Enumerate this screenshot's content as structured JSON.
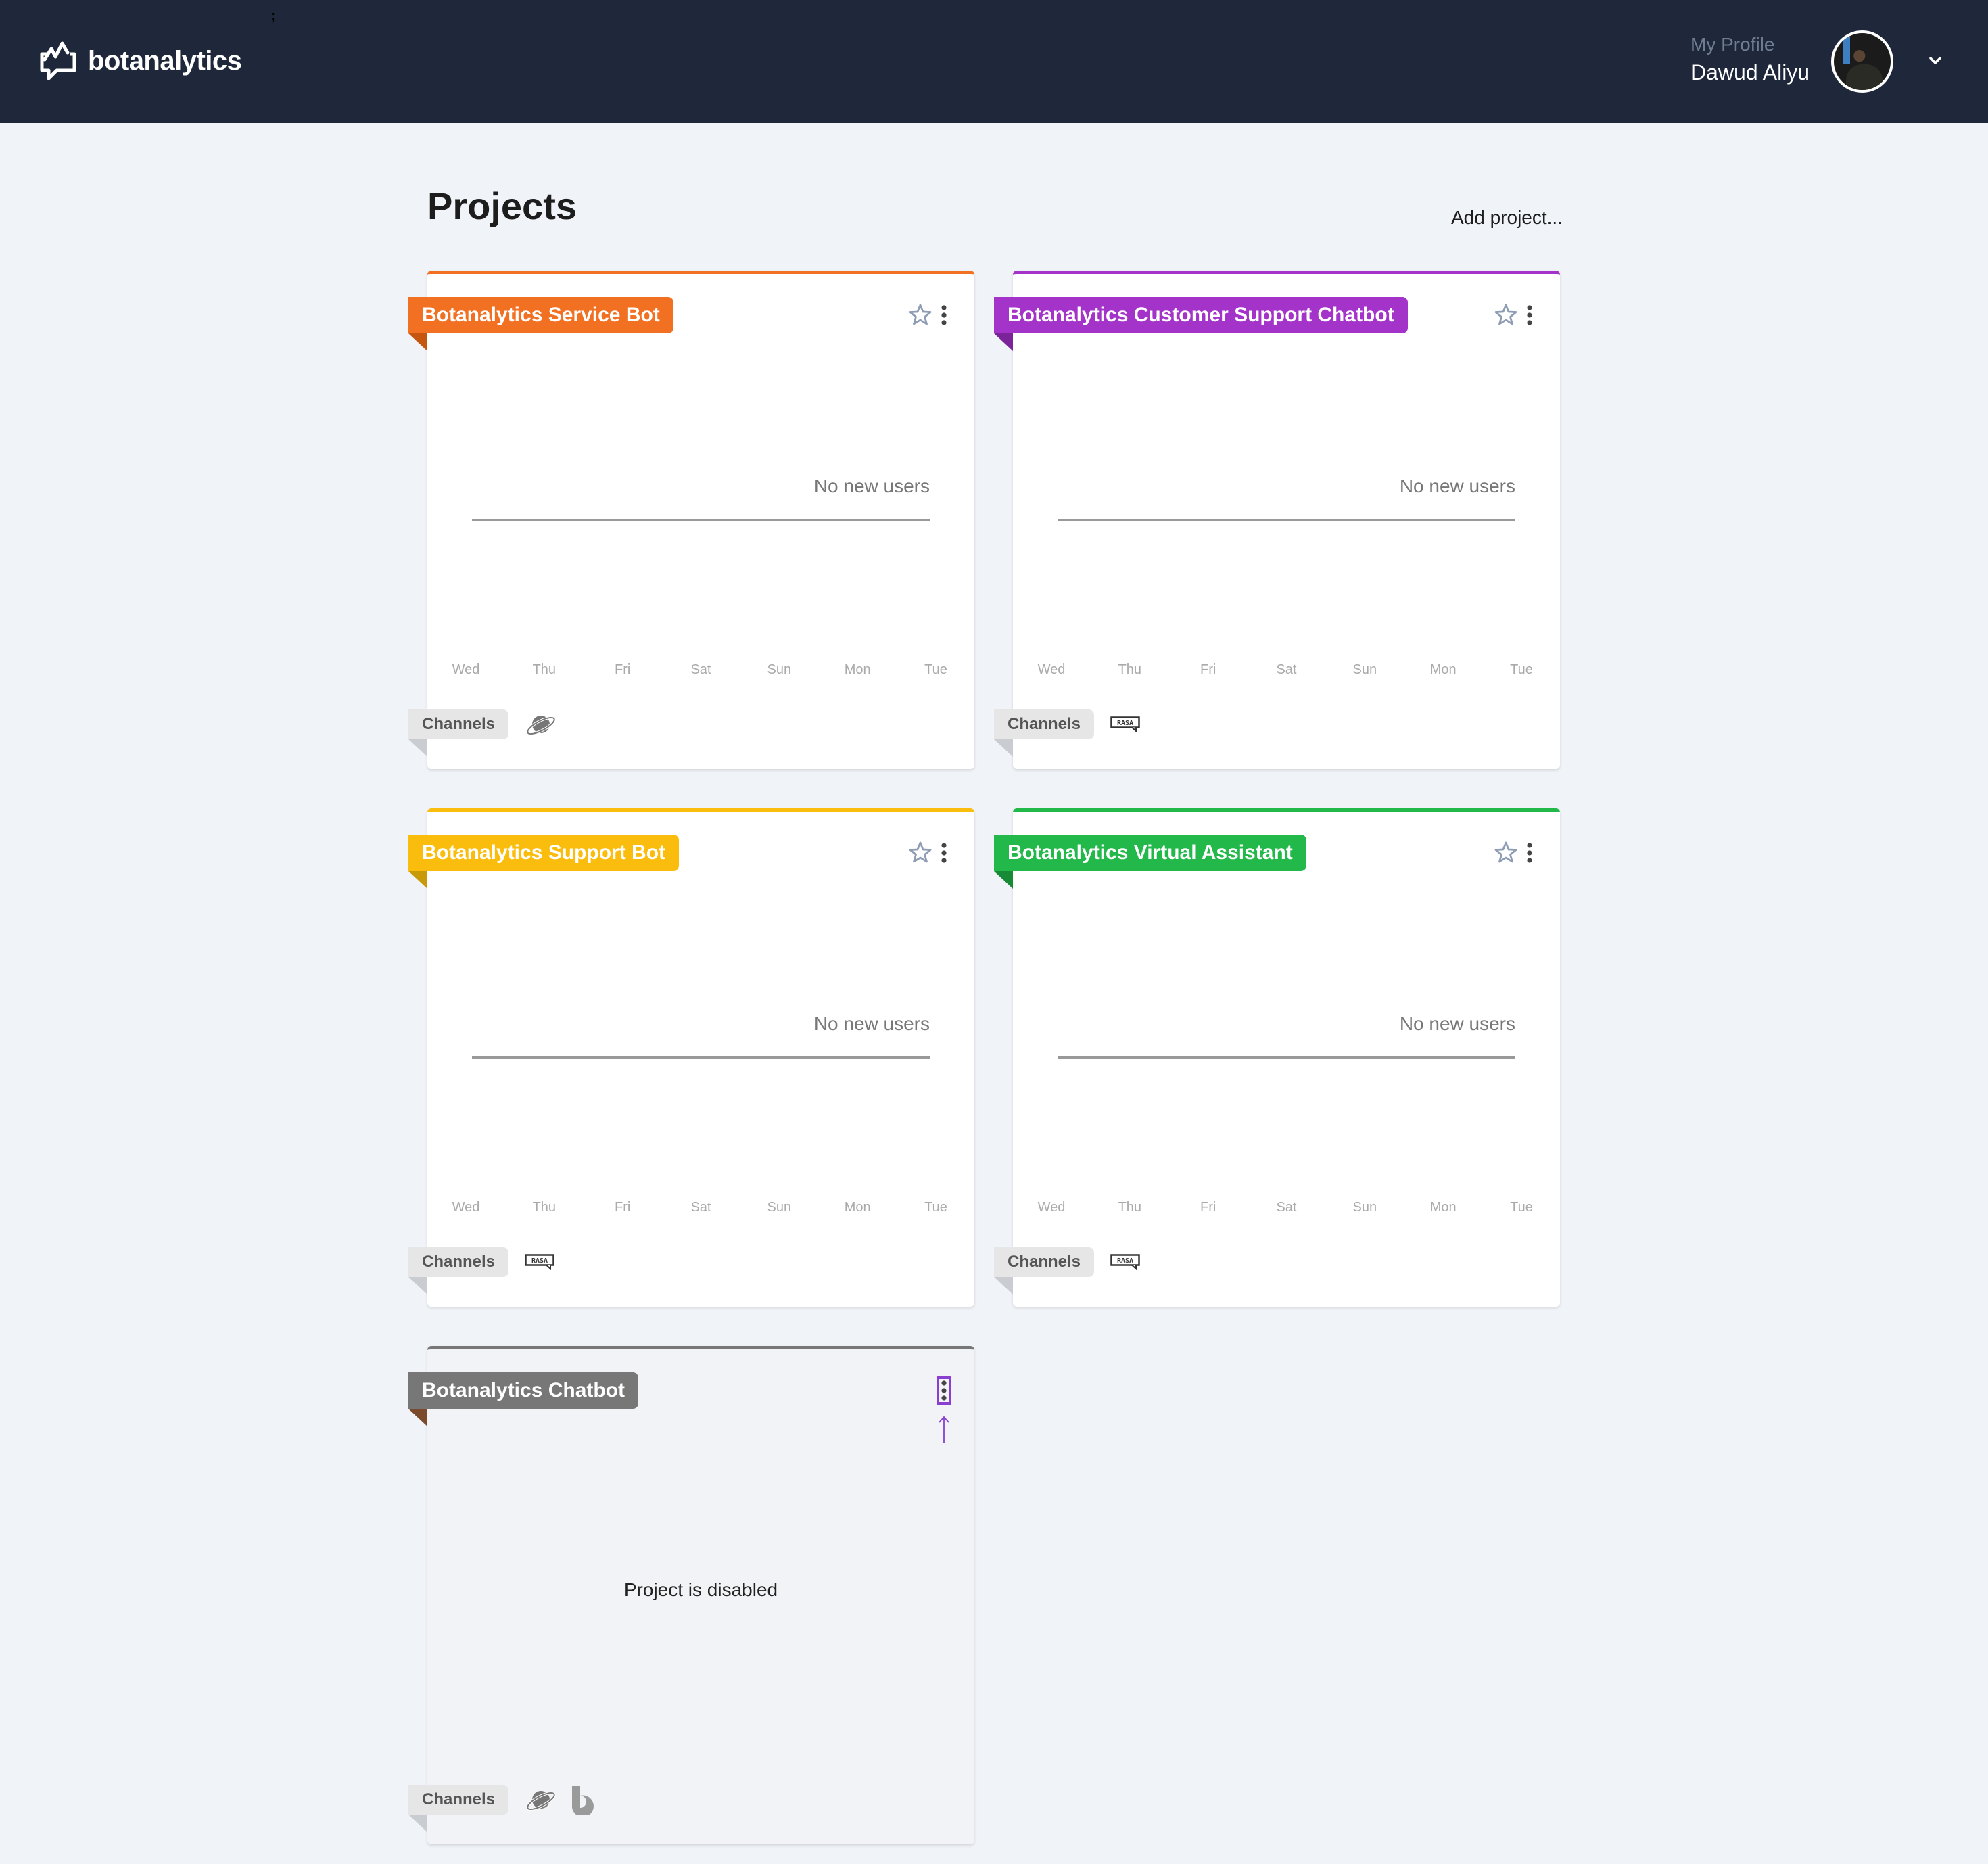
{
  "header": {
    "brand": "botanalytics",
    "stray_mark": ";",
    "profile_label": "My Profile",
    "user_name": "Dawud Aliyu"
  },
  "page": {
    "title": "Projects",
    "add_project": "Add project..."
  },
  "projects": [
    {
      "name": "Botanalytics Service Bot",
      "color": "#f27021",
      "fold_color": "#c4560f",
      "chart_message": "No new users",
      "days": [
        "Wed",
        "Thu",
        "Fri",
        "Sat",
        "Sun",
        "Mon",
        "Tue"
      ],
      "channels_label": "Channels",
      "channels": [
        "planet-icon"
      ],
      "favorite": false,
      "disabled": false
    },
    {
      "name": "Botanalytics Customer Support Chatbot",
      "color": "#a434c9",
      "fold_color": "#7b2499",
      "chart_message": "No new users",
      "days": [
        "Wed",
        "Thu",
        "Fri",
        "Sat",
        "Sun",
        "Mon",
        "Tue"
      ],
      "channels_label": "Channels",
      "channels": [
        "rasa-icon"
      ],
      "favorite": false,
      "disabled": false
    },
    {
      "name": "Botanalytics Support Bot",
      "color": "#fbbd0d",
      "fold_color": "#c99a08",
      "chart_message": "No new users",
      "days": [
        "Wed",
        "Thu",
        "Fri",
        "Sat",
        "Sun",
        "Mon",
        "Tue"
      ],
      "channels_label": "Channels",
      "channels": [
        "rasa-icon"
      ],
      "favorite": false,
      "disabled": false
    },
    {
      "name": "Botanalytics Virtual Assistant",
      "color": "#22b84a",
      "fold_color": "#178a36",
      "chart_message": "No new users",
      "days": [
        "Wed",
        "Thu",
        "Fri",
        "Sat",
        "Sun",
        "Mon",
        "Tue"
      ],
      "channels_label": "Channels",
      "channels": [
        "rasa-icon"
      ],
      "favorite": false,
      "disabled": false
    },
    {
      "name": "Botanalytics Chatbot",
      "color": "#777777",
      "fold_color": "#7a4a2a",
      "disabled_message": "Project is disabled",
      "channels_label": "Channels",
      "channels": [
        "planet-icon",
        "bixby-icon"
      ],
      "disabled": true
    }
  ],
  "colors": {
    "header_bg": "#1f283b",
    "page_bg": "#f0f3f7",
    "focus_outline": "#8a3fd1"
  }
}
